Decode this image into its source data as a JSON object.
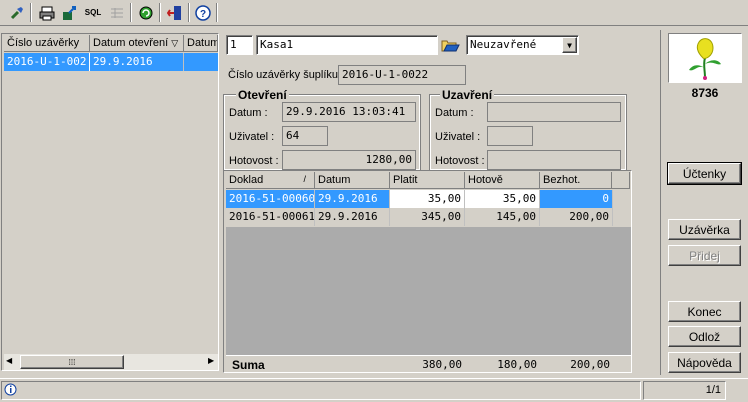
{
  "toolbar": {
    "icons": [
      "tool-icon",
      "print-icon",
      "export-icon",
      "sql-icon",
      "grid-icon",
      "refresh-icon",
      "exit-icon",
      "help-icon"
    ],
    "sql_label": "SQL"
  },
  "left_grid": {
    "columns": [
      "Číslo uzávěrky",
      "Datum otevření",
      "Datum"
    ],
    "rows": [
      {
        "cislo": "2016-U-1-002",
        "datum": "29.9.2016"
      }
    ]
  },
  "form": {
    "register_no": "1",
    "register_name": "Kasa1",
    "state": "Neuzavřené",
    "safe_label": "Číslo uzávěrky šuplíku",
    "safe_value": "2016-U-1-0022"
  },
  "otevreni": {
    "title": "Otevření",
    "datum_label": "Datum :",
    "datum_value": "29.9.2016 13:03:41",
    "uzivatel_label": "Uživatel :",
    "uzivatel_value": "64",
    "hotovost_label": "Hotovost :",
    "hotovost_value": "1280,00"
  },
  "uzavreni": {
    "title": "Uzavření",
    "datum_label": "Datum :",
    "datum_value": "",
    "uzivatel_label": "Uživatel :",
    "uzivatel_value": "",
    "hotovost_label": "Hotovost :",
    "hotovost_value": ""
  },
  "docs": {
    "columns": [
      "Doklad",
      "Datum",
      "Platit",
      "Hotově",
      "Bezhot."
    ],
    "rows": [
      {
        "doklad": "2016-51-00060",
        "datum": "29.9.2016",
        "platit": "35,00",
        "hotove": "35,00",
        "bezhot": "0"
      },
      {
        "doklad": "2016-51-00061",
        "datum": "29.9.2016",
        "platit": "345,00",
        "hotove": "145,00",
        "bezhot": "200,00"
      }
    ],
    "suma_label": "Suma",
    "suma_platit": "380,00",
    "suma_hotove": "180,00",
    "suma_bezhot": "200,00"
  },
  "side": {
    "logo_code": "8736",
    "btn_uctenky": "Účtenky",
    "btn_uzaverka": "Uzávěrka",
    "btn_pridej": "Přidej",
    "btn_konec": "Konec",
    "btn_odloz": "Odlož",
    "btn_napoveda": "Nápověda"
  },
  "status": {
    "pages": "1/1"
  }
}
